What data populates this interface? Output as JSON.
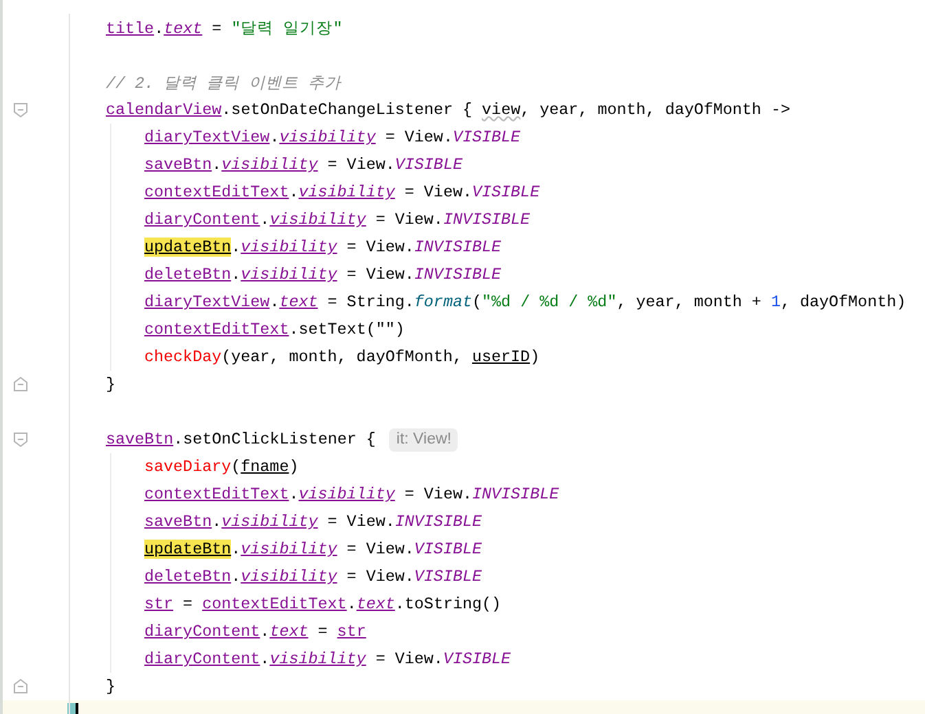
{
  "editor": {
    "lines": [
      {
        "tokens": [
          {
            "text": "title",
            "kind": "var"
          },
          {
            "text": ".",
            "kind": "plain"
          },
          {
            "text": "text",
            "kind": "prop"
          },
          {
            "text": " = ",
            "kind": "plain"
          },
          {
            "text": "\"달력 일기장\"",
            "kind": "string"
          }
        ]
      },
      {
        "kind": "blank"
      },
      {
        "tokens": [
          {
            "text": "// 2. 달력 클릭 이벤트 추가",
            "kind": "comment"
          }
        ]
      },
      {
        "kind": "block-start",
        "tokens": [
          {
            "text": "calendarView",
            "kind": "var"
          },
          {
            "text": ".setOnDateChangeListener { ",
            "kind": "plain"
          },
          {
            "text": "view",
            "kind": "unused"
          },
          {
            "text": ", year, month, dayOfMonth ->",
            "kind": "plain"
          }
        ],
        "children": [
          {
            "tokens": [
              {
                "text": "diaryTextView",
                "kind": "var"
              },
              {
                "text": ".",
                "kind": "plain"
              },
              {
                "text": "visibility",
                "kind": "prop"
              },
              {
                "text": " = View.",
                "kind": "plain"
              },
              {
                "text": "VISIBLE",
                "kind": "const"
              }
            ]
          },
          {
            "tokens": [
              {
                "text": "saveBtn",
                "kind": "var"
              },
              {
                "text": ".",
                "kind": "plain"
              },
              {
                "text": "visibility",
                "kind": "prop"
              },
              {
                "text": " = View.",
                "kind": "plain"
              },
              {
                "text": "VISIBLE",
                "kind": "const"
              }
            ]
          },
          {
            "tokens": [
              {
                "text": "contextEditText",
                "kind": "var"
              },
              {
                "text": ".",
                "kind": "plain"
              },
              {
                "text": "visibility",
                "kind": "prop"
              },
              {
                "text": " = View.",
                "kind": "plain"
              },
              {
                "text": "VISIBLE",
                "kind": "const"
              }
            ]
          },
          {
            "tokens": [
              {
                "text": "diaryContent",
                "kind": "var"
              },
              {
                "text": ".",
                "kind": "plain"
              },
              {
                "text": "visibility",
                "kind": "prop"
              },
              {
                "text": " = View.",
                "kind": "plain"
              },
              {
                "text": "INVISIBLE",
                "kind": "const"
              }
            ]
          },
          {
            "tokens": [
              {
                "text": "updateBtn",
                "kind": "highlight"
              },
              {
                "text": ".",
                "kind": "plain"
              },
              {
                "text": "visibility",
                "kind": "prop"
              },
              {
                "text": " = View.",
                "kind": "plain"
              },
              {
                "text": "INVISIBLE",
                "kind": "const"
              }
            ]
          },
          {
            "tokens": [
              {
                "text": "deleteBtn",
                "kind": "var"
              },
              {
                "text": ".",
                "kind": "plain"
              },
              {
                "text": "visibility",
                "kind": "prop"
              },
              {
                "text": " = View.",
                "kind": "plain"
              },
              {
                "text": "INVISIBLE",
                "kind": "const"
              }
            ]
          },
          {
            "tokens": [
              {
                "text": "diaryTextView",
                "kind": "var"
              },
              {
                "text": ".",
                "kind": "plain"
              },
              {
                "text": "text",
                "kind": "prop"
              },
              {
                "text": " = String.",
                "kind": "plain"
              },
              {
                "text": "format",
                "kind": "static"
              },
              {
                "text": "(",
                "kind": "plain"
              },
              {
                "text": "\"%d / %d / %d\"",
                "kind": "string"
              },
              {
                "text": ", year, month + ",
                "kind": "plain"
              },
              {
                "text": "1",
                "kind": "number"
              },
              {
                "text": ", dayOfMonth)",
                "kind": "plain"
              }
            ]
          },
          {
            "tokens": [
              {
                "text": "contextEditText",
                "kind": "var"
              },
              {
                "text": ".setText(\"\")",
                "kind": "plain"
              }
            ]
          },
          {
            "tokens": [
              {
                "text": "checkDay",
                "kind": "error"
              },
              {
                "text": "(year, month, dayOfMonth, ",
                "kind": "plain"
              },
              {
                "text": "userID",
                "kind": "field"
              },
              {
                "text": ")",
                "kind": "plain"
              }
            ]
          }
        ]
      },
      {
        "kind": "block-end",
        "tokens": [
          {
            "text": "}",
            "kind": "plain"
          }
        ]
      },
      {
        "kind": "blank"
      },
      {
        "kind": "block-start",
        "tokens": [
          {
            "text": "saveBtn",
            "kind": "var"
          },
          {
            "text": ".setOnClickListener {",
            "kind": "plain"
          }
        ],
        "hint": "it: View!",
        "children": [
          {
            "tokens": [
              {
                "text": "saveDiary",
                "kind": "error"
              },
              {
                "text": "(",
                "kind": "plain"
              },
              {
                "text": "fname",
                "kind": "field"
              },
              {
                "text": ")",
                "kind": "plain"
              }
            ]
          },
          {
            "tokens": [
              {
                "text": "contextEditText",
                "kind": "var"
              },
              {
                "text": ".",
                "kind": "plain"
              },
              {
                "text": "visibility",
                "kind": "prop"
              },
              {
                "text": " = View.",
                "kind": "plain"
              },
              {
                "text": "INVISIBLE",
                "kind": "const"
              }
            ]
          },
          {
            "tokens": [
              {
                "text": "saveBtn",
                "kind": "var"
              },
              {
                "text": ".",
                "kind": "plain"
              },
              {
                "text": "visibility",
                "kind": "prop"
              },
              {
                "text": " = View.",
                "kind": "plain"
              },
              {
                "text": "INVISIBLE",
                "kind": "const"
              }
            ]
          },
          {
            "tokens": [
              {
                "text": "updateBtn",
                "kind": "highlight"
              },
              {
                "text": ".",
                "kind": "plain"
              },
              {
                "text": "visibility",
                "kind": "prop"
              },
              {
                "text": " = View.",
                "kind": "plain"
              },
              {
                "text": "VISIBLE",
                "kind": "const"
              }
            ]
          },
          {
            "tokens": [
              {
                "text": "deleteBtn",
                "kind": "var"
              },
              {
                "text": ".",
                "kind": "plain"
              },
              {
                "text": "visibility",
                "kind": "prop"
              },
              {
                "text": " = View.",
                "kind": "plain"
              },
              {
                "text": "VISIBLE",
                "kind": "const"
              }
            ]
          },
          {
            "tokens": [
              {
                "text": "str",
                "kind": "var"
              },
              {
                "text": " = ",
                "kind": "plain"
              },
              {
                "text": "contextEditText",
                "kind": "var"
              },
              {
                "text": ".",
                "kind": "plain"
              },
              {
                "text": "text",
                "kind": "prop"
              },
              {
                "text": ".toString()",
                "kind": "plain"
              }
            ]
          },
          {
            "tokens": [
              {
                "text": "diaryContent",
                "kind": "var"
              },
              {
                "text": ".",
                "kind": "plain"
              },
              {
                "text": "text",
                "kind": "prop"
              },
              {
                "text": " = ",
                "kind": "plain"
              },
              {
                "text": "str",
                "kind": "var"
              }
            ]
          },
          {
            "tokens": [
              {
                "text": "diaryContent",
                "kind": "var"
              },
              {
                "text": ".",
                "kind": "plain"
              },
              {
                "text": "visibility",
                "kind": "prop"
              },
              {
                "text": " = View.",
                "kind": "plain"
              },
              {
                "text": "VISIBLE",
                "kind": "const"
              }
            ]
          }
        ]
      },
      {
        "kind": "block-end",
        "tokens": [
          {
            "text": "}",
            "kind": "plain"
          }
        ]
      }
    ]
  }
}
